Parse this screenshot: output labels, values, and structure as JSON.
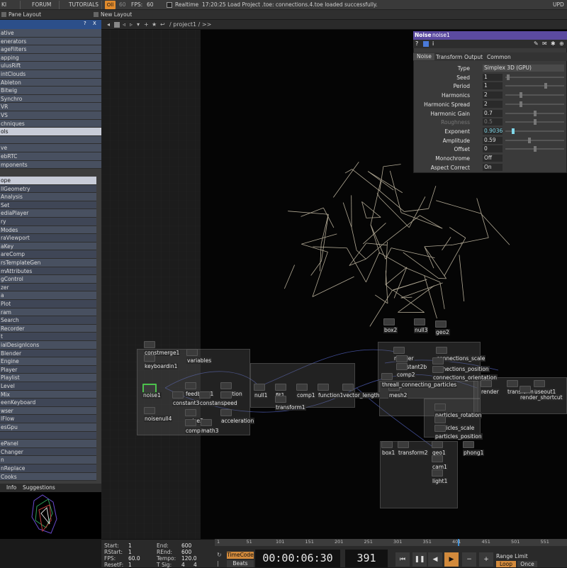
{
  "menubar": {
    "items": [
      "KI",
      "FORUM",
      "TUTORIALS"
    ],
    "perf": "Oll",
    "fps_target": "60",
    "fps_label": "FPS:",
    "fps_value": "60",
    "realtime": "Realtime",
    "status": "17:20:25 Load Project .toe: connections.4.toe loaded successfully.",
    "right": "UPD"
  },
  "tabbar": {
    "tabs": [
      "Pane Layout",
      "New Layout"
    ]
  },
  "sidebar": {
    "help": "?",
    "close": "X",
    "items_top": [
      "ative",
      "enerators",
      "ageFilters",
      "apping",
      "ulusRift",
      "intClouds",
      "Ableton",
      "Bitwig",
      "Synchro",
      "VR",
      "VS",
      "chniques",
      "ols",
      "",
      "ve",
      "ebRTC",
      "mponents"
    ],
    "items_bottom": [
      "ope",
      "llGeometry",
      "Analysis",
      "Set",
      "ediaPlayer",
      "ry",
      "Modes",
      "raViewport",
      "aKey",
      "areComp",
      "rsTemplateGen",
      "mAttributes",
      "gControl",
      "zer",
      "a",
      "Plot",
      "ram",
      "Search",
      "Recorder",
      "t",
      "ialDesignIcons",
      "Blender",
      "Engine",
      "Player",
      "Playlist",
      "Level",
      "Mix",
      "eenKeyboard",
      "wser",
      "lFlow",
      "esGpu",
      "",
      "ePanel",
      "Changer",
      "n",
      "nReplace",
      "Cooks"
    ]
  },
  "info_tabs": [
    "Info",
    "Suggestions"
  ],
  "netpath": {
    "path": "/ project1 / >>"
  },
  "nodes": [
    "constmerge1",
    "variables",
    "keyboardin1",
    "noise1",
    "feedback1",
    "position",
    "constant3",
    "constant2",
    "speed",
    "noisenull4",
    "noise3",
    "acceleration",
    "comp3",
    "math3",
    "null1",
    "fit1",
    "comp1",
    "function1",
    "vector_length",
    "transform1",
    "mesh2",
    "threall_connecting_particles",
    "box2",
    "null3",
    "geo2",
    "reorder",
    "connections_scale",
    "constant2b",
    "comp2",
    "connections_position",
    "connections_orientation",
    "render",
    "transform3",
    "useout1",
    "render_shortcut",
    "particles_rotation",
    "particles_scale",
    "particles_position",
    "box1",
    "transform2",
    "geo1",
    "cam1",
    "light1",
    "phong1"
  ],
  "params": {
    "op_type": "Noise",
    "op_name": "noise1",
    "tabs": [
      "Noise",
      "Transform",
      "Output",
      "Common"
    ],
    "rows": [
      {
        "label": "Type",
        "value": "Simplex 3D (GPU)",
        "level": null
      },
      {
        "label": "Seed",
        "value": "1",
        "level": 0.02
      },
      {
        "label": "Period",
        "value": "1",
        "level": 0.7
      },
      {
        "label": "Harmonics",
        "value": "2",
        "level": 0.25
      },
      {
        "label": "Harmonic Spread",
        "value": "2",
        "level": 0.25
      },
      {
        "label": "Harmonic Gain",
        "value": "0.7",
        "level": 0.5
      },
      {
        "label": "Roughness",
        "value": "0.5",
        "level": 0.5
      },
      {
        "label": "Exponent",
        "value": "0.9036",
        "level": 0.12
      },
      {
        "label": "Amplitude",
        "value": "0.59",
        "level": 0.4
      },
      {
        "label": "Offset",
        "value": "0",
        "level": 0.5
      },
      {
        "label": "Monochrome",
        "value": "Off",
        "level": null
      },
      {
        "label": "Aspect Correct",
        "value": "On",
        "level": null
      }
    ]
  },
  "timeline": {
    "start_l": "Start:",
    "start": "1",
    "end_l": "End:",
    "end": "600",
    "rstart_l": "RStart:",
    "rstart": "1",
    "rend_l": "REnd:",
    "rend": "600",
    "fps_l": "FPS:",
    "fps": "60.0",
    "tempo_l": "Tempo:",
    "tempo": "120.0",
    "resetf_l": "ResetF:",
    "resetf": "1",
    "tsig_l": "T Sig:",
    "tsig_a": "4",
    "tsig_b": "4",
    "ticks": [
      "1",
      "51",
      "101",
      "151",
      "201",
      "251",
      "301",
      "351",
      "401",
      "451",
      "501",
      "551"
    ],
    "timecode_btn": "TimeCode",
    "beats_btn": "Beats",
    "timecode": "00:00:06:30",
    "frame": "391",
    "range_limit": "Range Limit",
    "loop": "Loop",
    "once": "Once"
  },
  "colors": {
    "accent": "#e08a2c",
    "title": "#5b4aa0",
    "sidebar_head": "#2c4f8a"
  }
}
